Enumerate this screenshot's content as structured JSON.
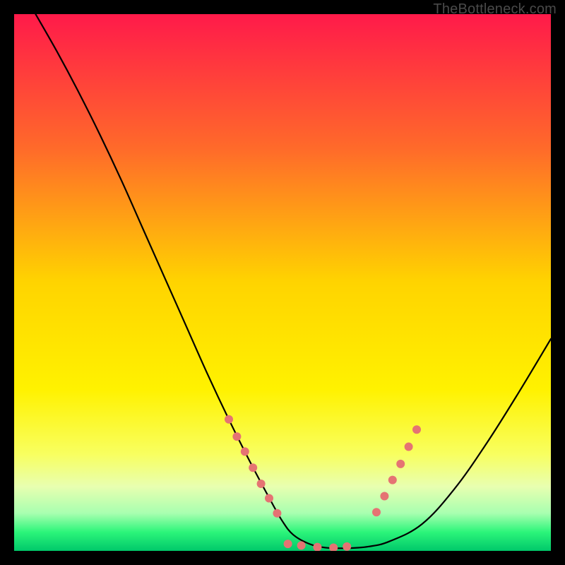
{
  "watermark": "TheBottleneck.com",
  "chart_data": {
    "type": "line",
    "title": "",
    "xlabel": "",
    "ylabel": "",
    "xlim": [
      0,
      100
    ],
    "ylim": [
      0,
      100
    ],
    "grid": false,
    "legend": false,
    "background_gradient": {
      "stops": [
        {
          "offset": 0.0,
          "color": "#ff1a4a"
        },
        {
          "offset": 0.25,
          "color": "#ff6a2a"
        },
        {
          "offset": 0.5,
          "color": "#ffd400"
        },
        {
          "offset": 0.7,
          "color": "#fff200"
        },
        {
          "offset": 0.82,
          "color": "#f8ff60"
        },
        {
          "offset": 0.88,
          "color": "#e8ffb0"
        },
        {
          "offset": 0.93,
          "color": "#a8ffb0"
        },
        {
          "offset": 0.965,
          "color": "#2cf57a"
        },
        {
          "offset": 1.0,
          "color": "#00c86a"
        }
      ]
    },
    "series": [
      {
        "name": "bottleneck-curve",
        "x": [
          4,
          8,
          12,
          16,
          20,
          24,
          28,
          32,
          36,
          40,
          44,
          48,
          50,
          52,
          55,
          58,
          62,
          66,
          70,
          76,
          82,
          88,
          94,
          100
        ],
        "y": [
          100,
          93,
          85.5,
          77.5,
          69,
          60,
          51,
          42,
          33,
          24.5,
          16.5,
          9,
          5.5,
          3,
          1.3,
          0.6,
          0.5,
          0.8,
          1.8,
          5,
          11.5,
          20,
          29.5,
          39.5
        ]
      }
    ],
    "highlight_points": {
      "name": "curve-markers",
      "color": "#e57373",
      "radius": 6,
      "points": [
        {
          "x": 40.0,
          "y": 24.5
        },
        {
          "x": 41.5,
          "y": 21.3
        },
        {
          "x": 43.0,
          "y": 18.5
        },
        {
          "x": 44.5,
          "y": 15.5
        },
        {
          "x": 46.0,
          "y": 12.5
        },
        {
          "x": 47.5,
          "y": 9.8
        },
        {
          "x": 49.0,
          "y": 7.0
        },
        {
          "x": 51.0,
          "y": 1.3
        },
        {
          "x": 53.5,
          "y": 1.0
        },
        {
          "x": 56.5,
          "y": 0.7
        },
        {
          "x": 59.5,
          "y": 0.6
        },
        {
          "x": 62.0,
          "y": 0.8
        },
        {
          "x": 67.5,
          "y": 7.2
        },
        {
          "x": 69.0,
          "y": 10.2
        },
        {
          "x": 70.5,
          "y": 13.2
        },
        {
          "x": 72.0,
          "y": 16.2
        },
        {
          "x": 73.5,
          "y": 19.4
        },
        {
          "x": 75.0,
          "y": 22.6
        }
      ]
    }
  }
}
